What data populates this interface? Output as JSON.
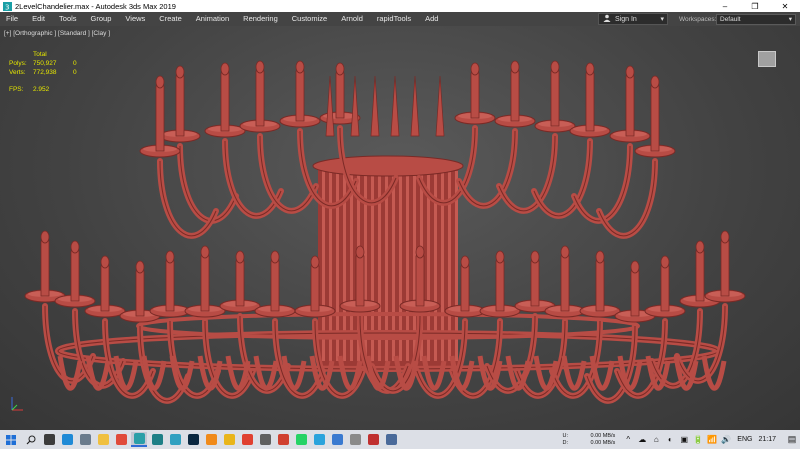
{
  "window": {
    "title": "2LevelChandelier.max - Autodesk 3ds Max 2019",
    "minimize": "–",
    "maximize": "❐",
    "close": "✕"
  },
  "menu": [
    "File",
    "Edit",
    "Tools",
    "Group",
    "Views",
    "Create",
    "Animation",
    "Rendering",
    "Customize",
    "Arnold",
    "rapidTools",
    "Add"
  ],
  "account": {
    "label": "Sign In",
    "caret": "▾",
    "icon": "person-icon"
  },
  "workspace": {
    "label": "Workspaces:",
    "value": "Default",
    "caret": "▾"
  },
  "viewport": {
    "label": "[+] [Orthographic ] [Standard ] [Clay ]",
    "stats": {
      "header": "Total",
      "polys_label": "Polys:",
      "polys_total": "750,927",
      "polys_sel": "0",
      "verts_label": "Verts:",
      "verts_total": "772,938",
      "verts_sel": "0",
      "fps_label": "FPS:",
      "fps_value": "2.952"
    },
    "model_color": "#b84c45",
    "background_color": "#4a4a4a"
  },
  "taskbar": {
    "start": "⊞",
    "search": "⚲",
    "apps": [
      {
        "name": "task-view-icon",
        "color": "#3c3c3c"
      },
      {
        "name": "edge-icon",
        "color": "#1f8ad6"
      },
      {
        "name": "notepad-icon",
        "color": "#6a7b8c"
      },
      {
        "name": "folder-icon",
        "color": "#f0c040"
      },
      {
        "name": "chrome-icon",
        "color": "#e04a3a"
      },
      {
        "name": "3dsmax-icon",
        "color": "#2a9fa8"
      },
      {
        "name": "3dsmax-icon-2",
        "color": "#1e7f86"
      },
      {
        "name": "media-icon",
        "color": "#30a0c0"
      },
      {
        "name": "photoshop-icon",
        "color": "#0a2740"
      },
      {
        "name": "illustrator-icon",
        "color": "#f08a1a"
      },
      {
        "name": "marvelous-icon",
        "color": "#e9b51a"
      },
      {
        "name": "app-p-icon",
        "color": "#e04030"
      },
      {
        "name": "app-camera-icon",
        "color": "#606060"
      },
      {
        "name": "chrome-2-icon",
        "color": "#d04030"
      },
      {
        "name": "whatsapp-icon",
        "color": "#25d366"
      },
      {
        "name": "telegram-icon",
        "color": "#2aa3dc"
      },
      {
        "name": "app-blue-icon",
        "color": "#3a7ad0"
      },
      {
        "name": "app-grey-icon",
        "color": "#8a8a8a"
      },
      {
        "name": "app-red-icon",
        "color": "#c03030"
      },
      {
        "name": "app-window-icon",
        "color": "#4a6a9a"
      }
    ]
  },
  "tray": {
    "upload_label": "U:",
    "upload_value": "0.00 MB/s",
    "download_label": "D:",
    "download_value": "0.00 MB/s",
    "language": "ENG",
    "time": "21:17",
    "icons": [
      "^",
      "☁",
      "⌂",
      "◐",
      "▣",
      "🔋",
      "📶",
      "🔊"
    ],
    "notifications": "▤"
  }
}
